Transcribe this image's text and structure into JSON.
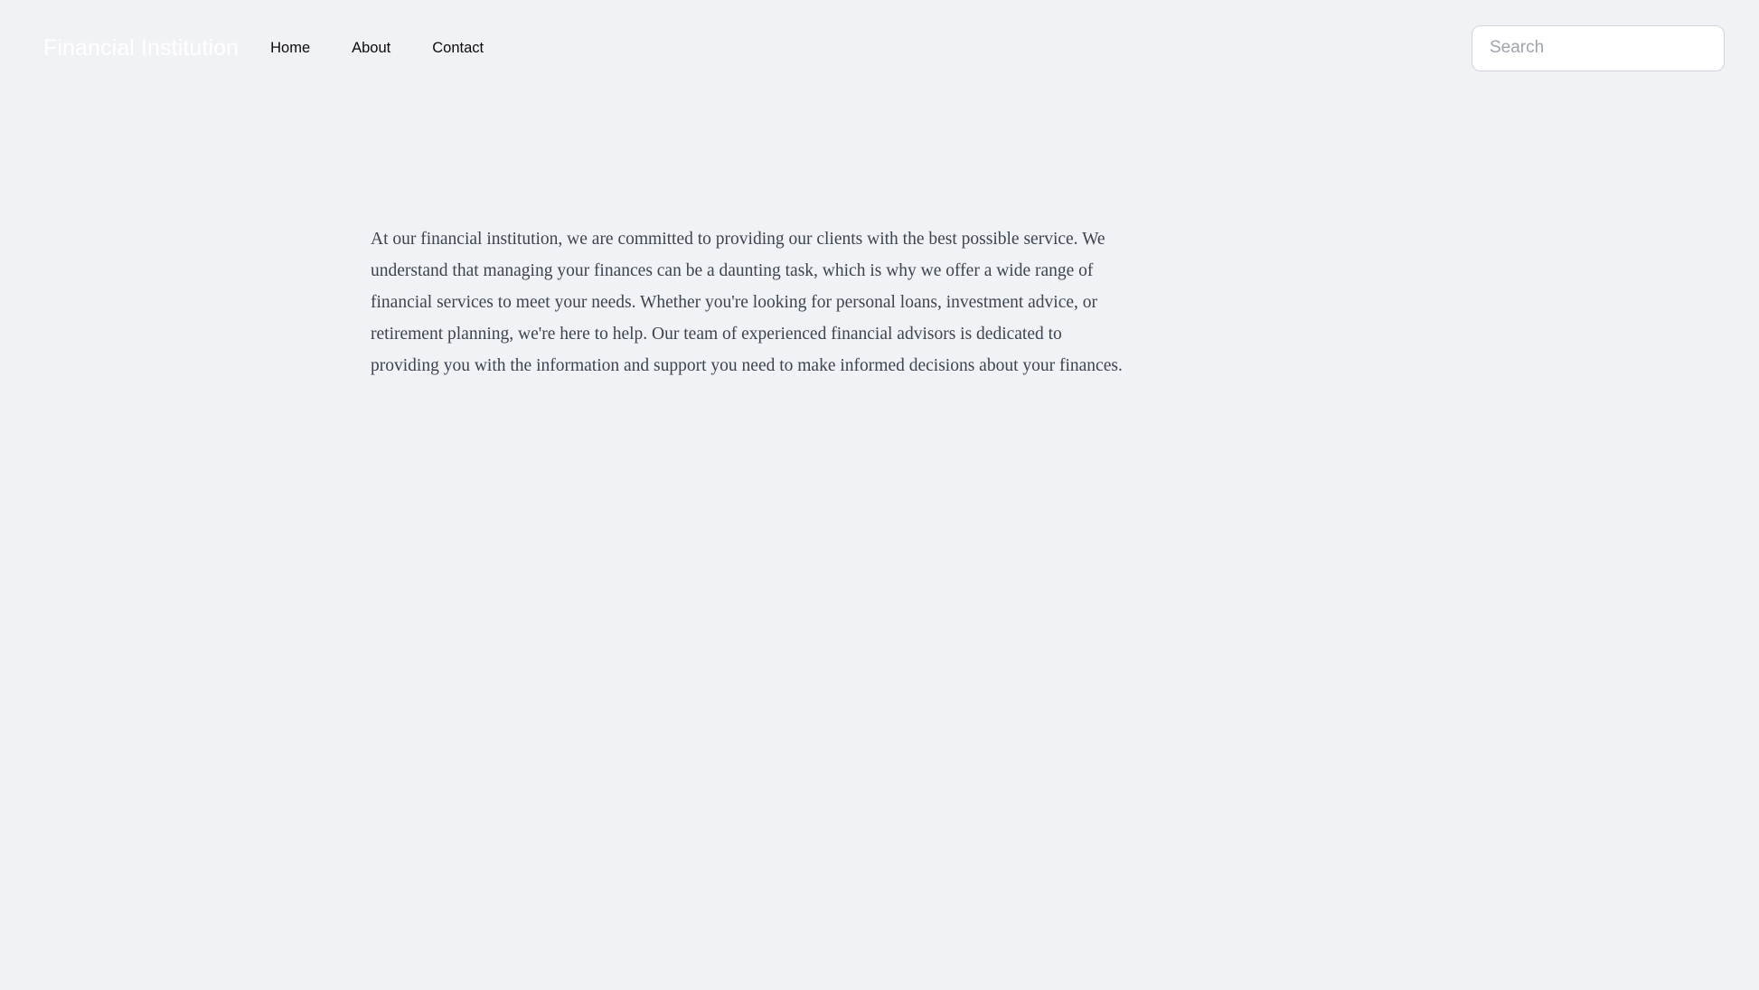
{
  "page": {
    "background_color": "#f1f2f6"
  },
  "header": {
    "brand": "Financial Institution",
    "brand_color": "#ffffff",
    "nav": [
      {
        "label": "Home"
      },
      {
        "label": "About"
      },
      {
        "label": "Contact"
      }
    ],
    "search": {
      "placeholder": "Search",
      "value": "",
      "border_color": "#d1d5db",
      "background_color": "#ffffff"
    }
  },
  "main": {
    "paragraph": "At our financial institution, we are committed to providing our clients with the best possible service. We understand that managing your finances can be a daunting task, which is why we offer a wide range of financial services to meet your needs. Whether you're looking for personal loans, investment advice, or retirement planning, we're here to help. Our team of experienced financial advisors is dedicated to providing you with the information and support you need to make informed decisions about your finances.",
    "text_color": "#3c4450"
  }
}
